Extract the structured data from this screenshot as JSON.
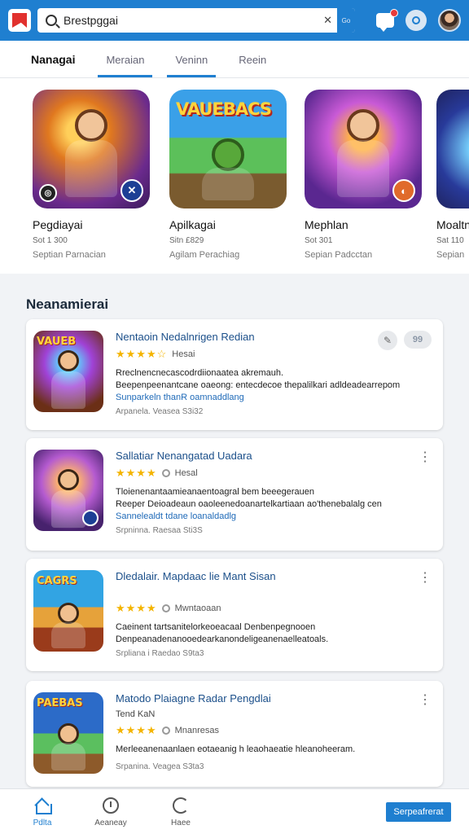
{
  "header": {
    "search_value": "Brestpggai",
    "search_button": "Go"
  },
  "tabs": [
    {
      "label": "Nanagai"
    },
    {
      "label": "Meraian"
    },
    {
      "label": "Veninn"
    },
    {
      "label": "Reein"
    }
  ],
  "featured": [
    {
      "name": "Pegdiayai",
      "meta": "Sot 1 300",
      "sub": "Septian Parnacian"
    },
    {
      "name": "Apilkagai",
      "meta": "Sitn £829",
      "sub": "Agilam Perachiag",
      "art_title": "VAUEBACS"
    },
    {
      "name": "Mephlan",
      "meta": "Sot 301",
      "sub": "Sepian Padcctan"
    },
    {
      "name": "Moaltn",
      "meta": "Sat 110",
      "sub": "Sepian"
    }
  ],
  "section_title": "Neanamierai",
  "apps": [
    {
      "title": "Nentaoin Nedalnrigen Redian",
      "stars": "★★★★☆",
      "rating_label": "Hesai",
      "desc1": "Rreclnencnecascodrdiionaatea akremauh.",
      "desc2": "Beepenpeenantcane oaeong: entecdecoe thepalilkari adldeadearrepom",
      "link": "Sunparkeln thanR oamnaddlang",
      "meta": "Arpanela. Veasea S3i32",
      "pill_label": "99",
      "icon_title": "VAUEB"
    },
    {
      "title": "Sallatiar Nenangatad Uadara",
      "stars": "★★★★",
      "rating_label": "Hesal",
      "desc1": "Tloienenantaamieanaentoagral bem beeegerauen",
      "desc2": "Reeper Deioadeaun oaoleenedoanartelkartiaan ao'thenebalalg cen",
      "link": "Sannelealdt tdane loanaldadlg",
      "meta": "Srpninna. Raesaa Sti3S"
    },
    {
      "title": "Dledalair. Mapdaac lie Mant Sisan",
      "stars": "★★★★",
      "rating_label": "Mwntaoaan",
      "desc1": "Caeinent tartsanitelorkeoeacaal Denbenpegnooen",
      "desc2": "Denpeanadenanooedearkanondeligeanenaelleatoals.",
      "meta": "Srpliana i Raedao S9ta3",
      "icon_title": "CAGRS"
    },
    {
      "title": "Matodo Plaiagne Radar Pengdlai",
      "sub": "Tend KaN",
      "stars": "★★★★",
      "rating_label": "Mnanresas",
      "desc1": "Merleeanenaanlaen eotaeanig h leaohaeatie hleanoheeram.",
      "meta": "Srpanina. Veagea S3ta3",
      "icon_title": "PAEBAS"
    }
  ],
  "bottom_nav": [
    {
      "label": "Pdlta"
    },
    {
      "label": "Aeaneay"
    },
    {
      "label": "Haee"
    }
  ],
  "cta": "Serpeafrerat"
}
